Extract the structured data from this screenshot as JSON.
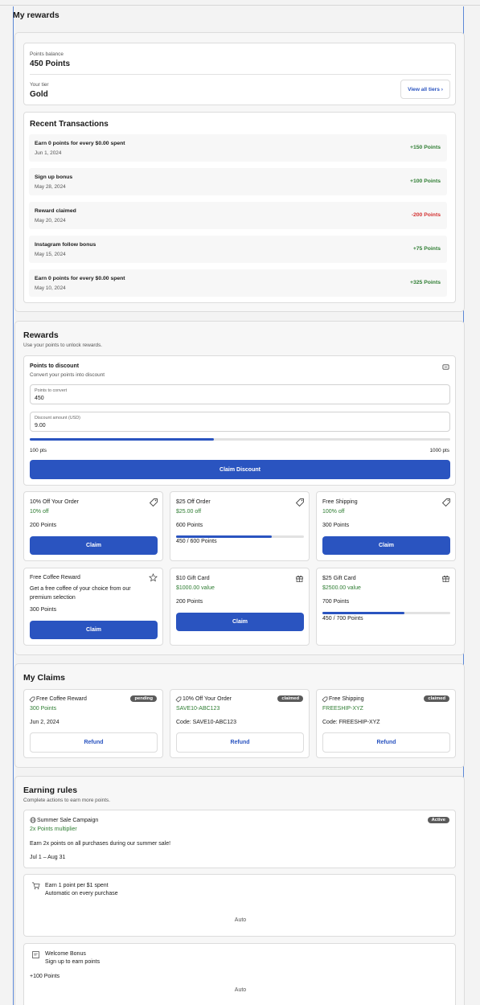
{
  "page": {
    "title": "My rewards"
  },
  "summary": {
    "balance_label": "Points balance",
    "balance_value": "450 Points",
    "tier_label": "Your tier",
    "tier_value": "Gold",
    "view_tiers_label": "View all tiers ›"
  },
  "transactions": {
    "title": "Recent Transactions",
    "items": [
      {
        "title": "Earn 0 points for every $0.00 spent",
        "date": "Jun 1, 2024",
        "amount": "+150 Points",
        "kind": "positive"
      },
      {
        "title": "Sign up bonus",
        "date": "May 28, 2024",
        "amount": "+100 Points",
        "kind": "positive"
      },
      {
        "title": "Reward claimed",
        "date": "May 20, 2024",
        "amount": "-200 Points",
        "kind": "negative"
      },
      {
        "title": "Instagram follow bonus",
        "date": "May 15, 2024",
        "amount": "+75 Points",
        "kind": "positive"
      },
      {
        "title": "Earn 0 points for every $0.00 spent",
        "date": "May 10, 2024",
        "amount": "+325 Points",
        "kind": "positive"
      }
    ]
  },
  "rewards": {
    "title": "Rewards",
    "subtitle": "Use your points to unlock rewards.",
    "converter": {
      "title": "Points to discount",
      "subtitle": "Convert your points into discount",
      "points_label": "Points to convert",
      "points_value": "450",
      "discount_label": "Discount amount (USD)",
      "discount_value": "9.00",
      "min_label": "100 pts",
      "max_label": "1000 pts",
      "slider_fraction": 0.4375,
      "button_label": "Claim Discount"
    },
    "cards": [
      {
        "title": "10% Off Your Order",
        "value": "10% off",
        "points": "200 Points",
        "icon": "tag-icon",
        "action": "claim",
        "claim_label": "Claim"
      },
      {
        "title": "$25 Off Order",
        "value": "$25.00 off",
        "points": "600 Points",
        "icon": "tag-icon",
        "action": "progress",
        "progress_text": "450 / 600 Points",
        "progress": 0.75
      },
      {
        "title": "Free Shipping",
        "value": "100% off",
        "points": "300 Points",
        "icon": "tag-icon",
        "action": "claim",
        "claim_label": "Claim"
      },
      {
        "title": "Free Coffee Reward",
        "description": "Get a free coffee of your choice from our premium selection",
        "points": "300 Points",
        "icon": "star-icon",
        "action": "claim",
        "claim_label": "Claim"
      },
      {
        "title": "$10 Gift Card",
        "value": "$1000.00 value",
        "points": "200 Points",
        "icon": "gift-icon",
        "action": "claim",
        "claim_label": "Claim"
      },
      {
        "title": "$25 Gift Card",
        "value": "$2500.00 value",
        "points": "700 Points",
        "icon": "gift-icon",
        "action": "progress",
        "progress_text": "450 / 700 Points",
        "progress": 0.643
      }
    ]
  },
  "claims": {
    "title": "My Claims",
    "items": [
      {
        "title": "Free Coffee Reward",
        "sub": "300 Points",
        "badge": "pending",
        "detail": "Jun 2, 2024",
        "button": "Refund"
      },
      {
        "title": "10% Off Your Order",
        "sub": "SAVE10-ABC123",
        "badge": "claimed",
        "detail": "Code: SAVE10-ABC123",
        "button": "Refund"
      },
      {
        "title": "Free Shipping",
        "sub": "FREESHIP-XYZ",
        "badge": "claimed",
        "detail": "Code: FREESHIP-XYZ",
        "button": "Refund"
      }
    ]
  },
  "earning": {
    "title": "Earning rules",
    "subtitle": "Complete actions to earn more points.",
    "campaign": {
      "title": "Summer Sale Campaign",
      "multiplier": "2x Points multiplier",
      "badge": "Active",
      "description": "Earn 2x points on all purchases during our summer sale!",
      "dates": "Jul 1 – Aug 31"
    },
    "rules": [
      {
        "title": "Earn 1 point per $1 spent",
        "sub": "Automatic on every purchase",
        "extra": "",
        "status": "Auto",
        "icon": "cart-icon"
      },
      {
        "title": "Welcome Bonus",
        "sub": "Sign up to earn points",
        "extra": "+100 Points",
        "status": "Auto",
        "icon": "note-icon"
      }
    ]
  },
  "colors": {
    "accent": "#2a54c0",
    "positive": "#2e7d32",
    "negative": "#d32f2f",
    "frame": "#5b87d6"
  }
}
